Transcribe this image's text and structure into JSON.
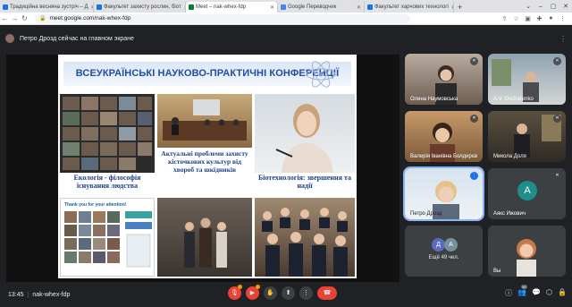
{
  "browser": {
    "tabs": [
      {
        "label": "Традиційна весняна зустріч – Д",
        "color": "#1a73e8",
        "active": false
      },
      {
        "label": "Факультет захисту рослин, біот",
        "color": "#1a73e8",
        "active": false
      },
      {
        "label": "Meet – nak-whex-fdp",
        "color": "#00832d",
        "active": true
      },
      {
        "label": "Google Переводчик",
        "color": "#4285f4",
        "active": false
      },
      {
        "label": "Факультет харчових технологі",
        "color": "#1a73e8",
        "active": false
      }
    ],
    "new_tab": "+",
    "url": "meet.google.com/nak-whex-fdp"
  },
  "notice": {
    "text": "Петро Дрозд сейчас на главном экране"
  },
  "slide": {
    "title": "ВСЕУКРАЇНСЬКІ НАУКОВО-ПРАКТИЧНІ КОНФЕРЕНЦІЇ",
    "captions": [
      "Екологія - філософія існування людства",
      "Актуальні проблеми захисту кісточкових культур від хвороб та шкідників",
      "Біотехнологія: звершення та надії"
    ],
    "thanks_text": "Thank you for your attention!"
  },
  "participants": [
    {
      "name": "Олена Наумовська",
      "type": "video"
    },
    {
      "name": "A.V. Ovcharenko",
      "type": "video"
    },
    {
      "name": "Валерія Іванівна Болдирєв",
      "type": "video"
    },
    {
      "name": "Микола Доля",
      "type": "video"
    },
    {
      "name": "Петро Дрозд",
      "type": "video",
      "active": true
    },
    {
      "name": "Аякс Ижович",
      "type": "avatar",
      "initial": "A",
      "avatar_color": "#1e8e8a"
    },
    {
      "name": "",
      "type": "group",
      "initials": [
        "Д",
        "А"
      ],
      "extra_label": "Ещё 49 чел."
    },
    {
      "name": "Вы",
      "type": "video"
    }
  ],
  "bottom": {
    "time": "13:45",
    "meeting_code": "nak-whex-fdp",
    "people_count": "56"
  },
  "colors": {
    "accent": "#8ab4f8",
    "danger": "#ea4335",
    "slide_title": "#1f4ea1"
  }
}
